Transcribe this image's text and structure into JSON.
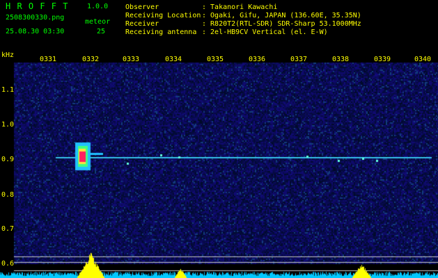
{
  "app": {
    "name": "H R O F F T",
    "version": "1.0.0",
    "filename": "2508300330.png",
    "datetime": "25.08.30 03:30",
    "meteor_label": "meteor",
    "meteor_count": "25"
  },
  "station": {
    "labels": [
      "Observer",
      "Receiving Location",
      "Receiver",
      "Receiving antenna"
    ],
    "values": [
      ": Takanori Kawachi",
      ": Ogaki, Gifu, JAPAN (136.60E, 35.35N)",
      ": R820T2(RTL-SDR) SDR-Sharp 53.1000MHz",
      ": 2el-HB9CV Vertical (el. E-W)"
    ]
  },
  "axis": {
    "unit": "kHz",
    "x_ticks": [
      "0331",
      "0332",
      "0333",
      "0334",
      "0335",
      "0336",
      "0337",
      "0338",
      "0339",
      "0340"
    ],
    "y_ticks": [
      "1.1",
      "1.0",
      "0.9",
      "0.8",
      "0.7",
      "0.6"
    ]
  },
  "colors": {
    "header_green": "#00ff00",
    "header_yellow": "#ffff00",
    "background": "#000000",
    "noise": "#0a1466",
    "trace": "#40e0ff",
    "echo_core": "#ff2060",
    "power_yellow": "#ffff00",
    "power_cyan": "#00c8ff"
  }
}
